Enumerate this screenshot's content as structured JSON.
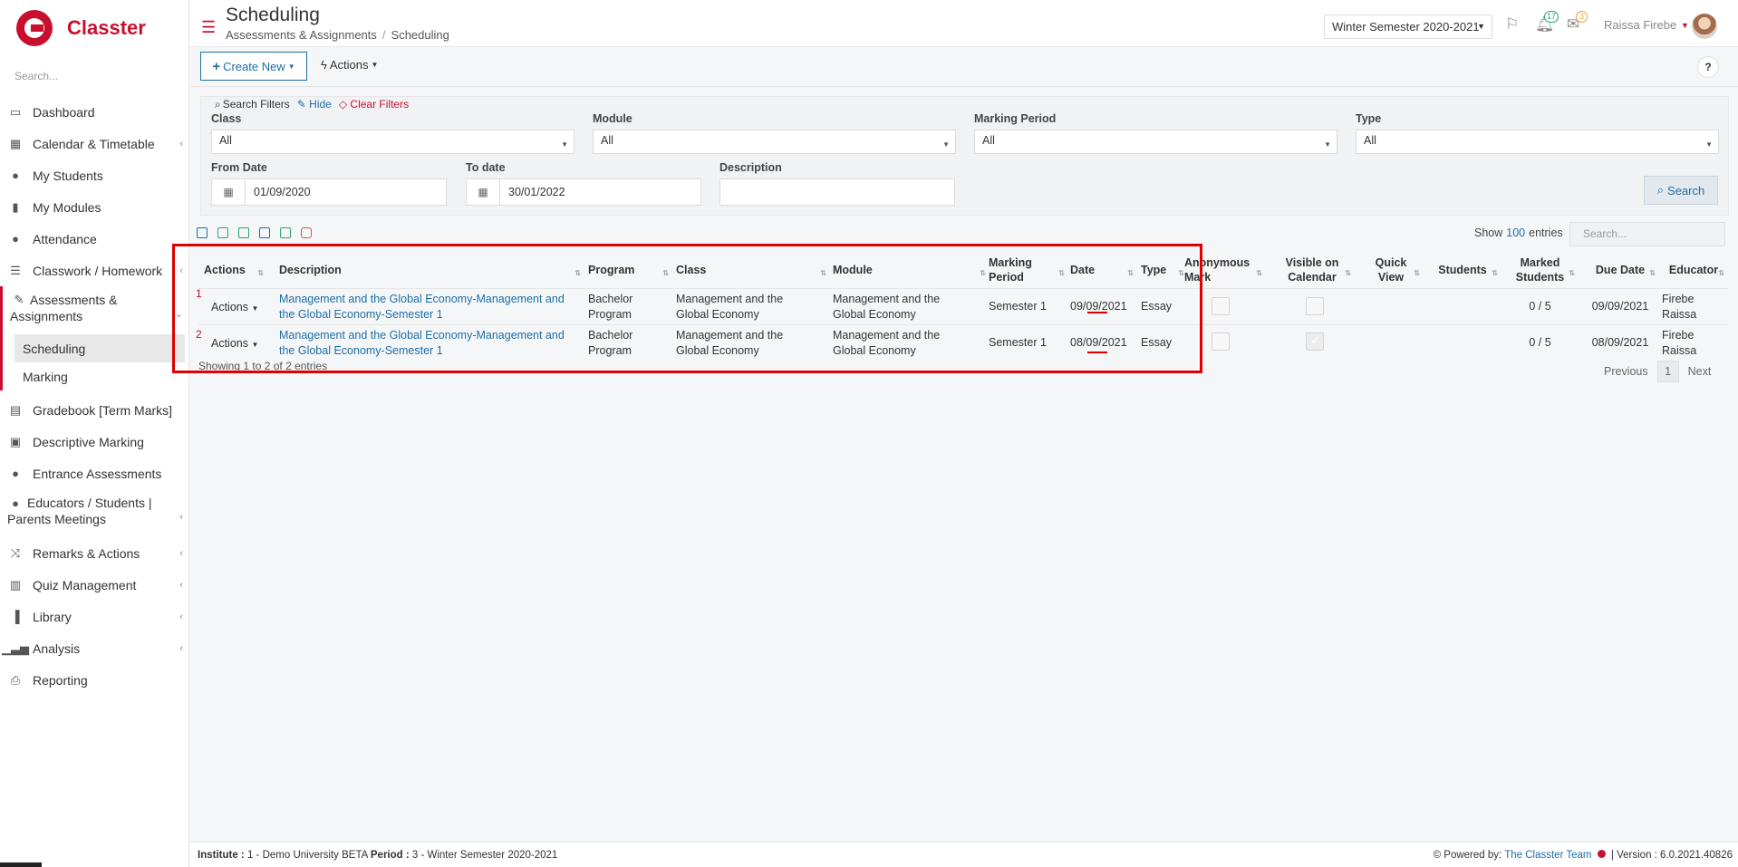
{
  "app": {
    "name": "Classter",
    "search_placeholder": "Search..."
  },
  "sidebar": {
    "items": [
      {
        "label": "Dashboard",
        "icon": "laptop-icon"
      },
      {
        "label": "Calendar & Timetable",
        "icon": "calendar-icon"
      },
      {
        "label": "My Students",
        "icon": "users-icon"
      },
      {
        "label": "My Modules",
        "icon": "book-icon"
      },
      {
        "label": "Attendance",
        "icon": "user-check-icon"
      },
      {
        "label": "Classwork / Homework",
        "icon": "list-icon"
      },
      {
        "label": "Assessments & Assignments",
        "icon": "edit-icon"
      },
      {
        "label": "Gradebook [Term Marks]",
        "icon": "gradebook-icon"
      },
      {
        "label": "Descriptive Marking",
        "icon": "marking-icon"
      },
      {
        "label": "Entrance Assessments",
        "icon": "user-edit-icon"
      },
      {
        "label": "Educators / Students | Parents Meetings",
        "icon": "meeting-icon"
      },
      {
        "label": "Remarks & Actions",
        "icon": "random-icon"
      },
      {
        "label": "Quiz Management",
        "icon": "quiz-icon"
      },
      {
        "label": "Library",
        "icon": "library-icon"
      },
      {
        "label": "Analysis",
        "icon": "chart-icon"
      },
      {
        "label": "Reporting",
        "icon": "print-icon"
      }
    ],
    "subitems": [
      {
        "label": "Scheduling"
      },
      {
        "label": "Marking"
      }
    ]
  },
  "header": {
    "title": "Scheduling",
    "breadcrumb": [
      "Assessments & Assignments",
      "Scheduling"
    ],
    "semester": "Winter Semester 2020-2021",
    "notifications": "17",
    "messages": "3",
    "user": "Raissa Firebe"
  },
  "toolbar": {
    "create_label": "Create New",
    "actions_label": "Actions",
    "help_label": "?"
  },
  "filters": {
    "heading": "Search Filters",
    "hide": "Hide",
    "clear": "Clear Filters",
    "class_label": "Class",
    "class_value": "All",
    "module_label": "Module",
    "module_value": "All",
    "period_label": "Marking Period",
    "period_value": "All",
    "type_label": "Type",
    "type_value": "All",
    "from_label": "From Date",
    "from_value": "01/09/2020",
    "to_label": "To date",
    "to_value": "30/01/2022",
    "desc_label": "Description",
    "desc_value": "",
    "search_button": "Search"
  },
  "table": {
    "show_label": "Show",
    "show_count": "100",
    "entries_label": "entries",
    "search_placeholder": "Search...",
    "headers": {
      "actions": "Actions",
      "description": "Description",
      "program": "Program",
      "class": "Class",
      "module": "Module",
      "marking_period": "Marking Period",
      "date": "Date",
      "type": "Type",
      "anonymous": "Anonymous Mark",
      "visible": "Visible on Calendar",
      "quick": "Quick View",
      "students": "Students",
      "marked": "Marked Students",
      "due": "Due Date",
      "educator": "Educator"
    },
    "rows": [
      {
        "num": "1",
        "actions": "Actions",
        "description": "Management and the Global Economy-Management and the Global Economy-Semester 1",
        "program": "Bachelor Program",
        "class": "Management and the Global Economy",
        "module": "Management and the Global Economy",
        "marking_period": "Semester 1",
        "date": "09/09/2021",
        "type": "Essay",
        "anonymous": false,
        "visible": false,
        "marked": "0 / 5",
        "due": "09/09/2021",
        "educator": "Firebe Raissa"
      },
      {
        "num": "2",
        "actions": "Actions",
        "description": "Management and the Global Economy-Management and the Global Economy-Semester 1",
        "program": "Bachelor Program",
        "class": "Management and the Global Economy",
        "module": "Management and the Global Economy",
        "marking_period": "Semester 1",
        "date": "08/09/2021",
        "type": "Essay",
        "anonymous": false,
        "visible": true,
        "marked": "0 / 5",
        "due": "08/09/2021",
        "educator": "Firebe Raissa"
      }
    ],
    "info": "Showing 1 to 2 of 2 entries",
    "pager": {
      "prev": "Previous",
      "page": "1",
      "next": "Next"
    }
  },
  "footer": {
    "institute_label": "Institute :",
    "institute_value": "1 - Demo University BETA",
    "period_label": "Period :",
    "period_value": "3 - Winter Semester 2020-2021",
    "powered": "Powered by:",
    "team": "The Classter Team",
    "version": "| Version : 6.0.2021.40826"
  },
  "colors": {
    "brand": "#c8102e",
    "link": "#1d6fa5",
    "annotation": "#e00000"
  }
}
